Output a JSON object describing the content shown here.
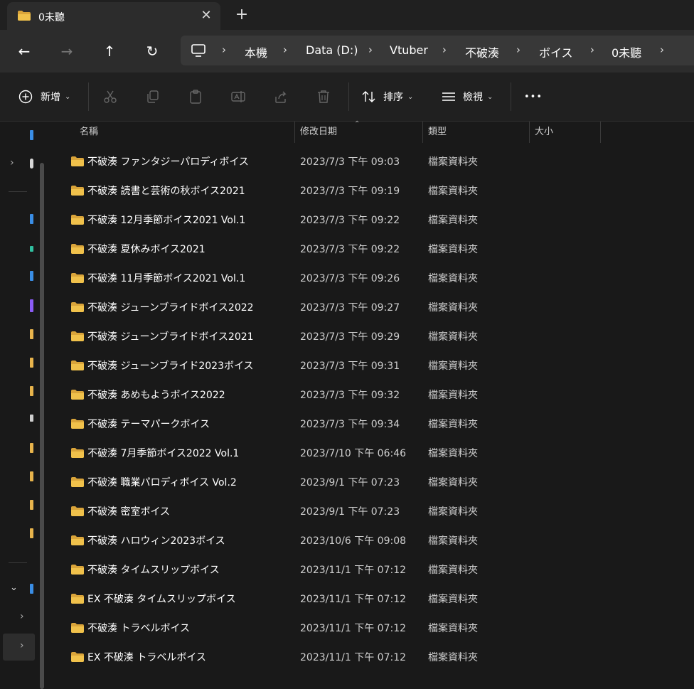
{
  "tab": {
    "title": "0未聽",
    "close": "✕",
    "new_tab": "+"
  },
  "nav": {
    "back": "←",
    "forward": "→",
    "up": "↑",
    "refresh": "↻"
  },
  "breadcrumb": [
    "本機",
    "Data (D:)",
    "Vtuber",
    "不破湊",
    "ボイス",
    "0未聽"
  ],
  "toolbar": {
    "new_label": "新增",
    "sort_label": "排序",
    "view_label": "檢視",
    "more_label": "•••"
  },
  "columns": {
    "name": "名稱",
    "modified": "修改日期",
    "type": "類型",
    "size": "大小"
  },
  "files": [
    {
      "name": "不破湊 ファンタジーパロディボイス",
      "modified": "2023/7/3 下午 09:03",
      "type": "檔案資料夾"
    },
    {
      "name": "不破湊 読書と芸術の秋ボイス2021",
      "modified": "2023/7/3 下午 09:19",
      "type": "檔案資料夾"
    },
    {
      "name": "不破湊 12月季節ボイス2021 Vol.1",
      "modified": "2023/7/3 下午 09:22",
      "type": "檔案資料夾"
    },
    {
      "name": "不破湊 夏休みボイス2021",
      "modified": "2023/7/3 下午 09:22",
      "type": "檔案資料夾"
    },
    {
      "name": "不破湊 11月季節ボイス2021 Vol.1",
      "modified": "2023/7/3 下午 09:26",
      "type": "檔案資料夾"
    },
    {
      "name": "不破湊 ジューンブライドボイス2022",
      "modified": "2023/7/3 下午 09:27",
      "type": "檔案資料夾"
    },
    {
      "name": "不破湊 ジューンブライドボイス2021",
      "modified": "2023/7/3 下午 09:29",
      "type": "檔案資料夾"
    },
    {
      "name": "不破湊 ジューンブライド2023ボイス",
      "modified": "2023/7/3 下午 09:31",
      "type": "檔案資料夾"
    },
    {
      "name": "不破湊 あめもようボイス2022",
      "modified": "2023/7/3 下午 09:32",
      "type": "檔案資料夾"
    },
    {
      "name": "不破湊 テーマパークボイス",
      "modified": "2023/7/3 下午 09:34",
      "type": "檔案資料夾"
    },
    {
      "name": "不破湊 7月季節ボイス2022 Vol.1",
      "modified": "2023/7/10 下午 06:46",
      "type": "檔案資料夾"
    },
    {
      "name": "不破湊 職業パロディボイス Vol.2",
      "modified": "2023/9/1 下午 07:23",
      "type": "檔案資料夾"
    },
    {
      "name": "不破湊 密室ボイス",
      "modified": "2023/9/1 下午 07:23",
      "type": "檔案資料夾"
    },
    {
      "name": "不破湊 ハロウィン2023ボイス",
      "modified": "2023/10/6 下午 09:08",
      "type": "檔案資料夾"
    },
    {
      "name": "不破湊 タイムスリップボイス",
      "modified": "2023/11/1 下午 07:12",
      "type": "檔案資料夾"
    },
    {
      "name": "EX 不破湊 タイムスリップボイス",
      "modified": "2023/11/1 下午 07:12",
      "type": "檔案資料夾"
    },
    {
      "name": "不破湊 トラベルボイス",
      "modified": "2023/11/1 下午 07:12",
      "type": "檔案資料夾"
    },
    {
      "name": "EX 不破湊 トラベルボイス",
      "modified": "2023/11/1 下午 07:12",
      "type": "檔案資料夾"
    }
  ],
  "colors": {
    "folder": "#f0c14b",
    "folder_dark": "#d9a43a"
  }
}
